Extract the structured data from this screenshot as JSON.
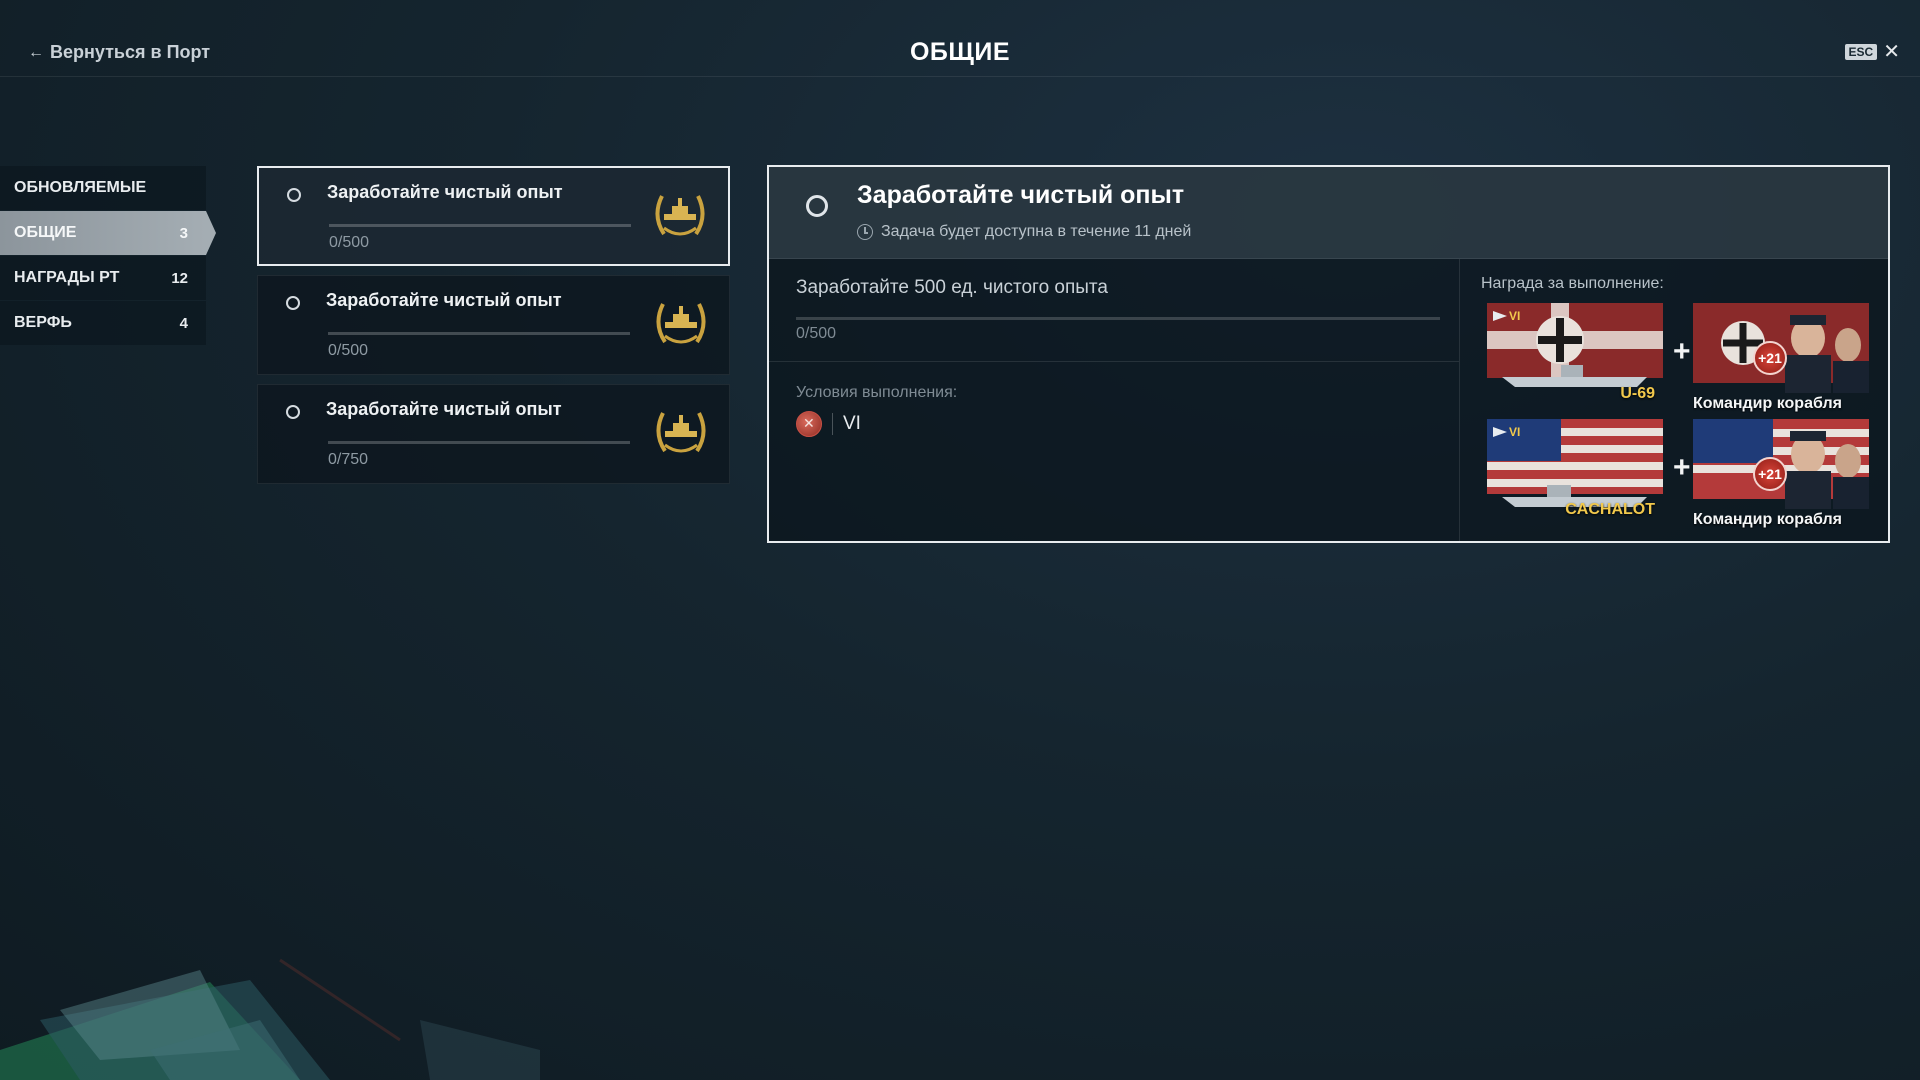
{
  "header": {
    "back_label": "Вернуться в Порт",
    "title": "ОБЩИЕ",
    "esc_label": "ESC"
  },
  "sidebar": {
    "items": [
      {
        "label": "ОБНОВЛЯЕМЫЕ",
        "count": ""
      },
      {
        "label": "ОБЩИЕ",
        "count": "3",
        "active": true
      },
      {
        "label": "НАГРАДЫ РТ",
        "count": "12"
      },
      {
        "label": "ВЕРФЬ",
        "count": "4"
      }
    ]
  },
  "tasks": [
    {
      "title": "Заработайте чистый опыт",
      "progress": "0/500",
      "selected": true
    },
    {
      "title": "Заработайте чистый опыт",
      "progress": "0/500"
    },
    {
      "title": "Заработайте чистый опыт",
      "progress": "0/750"
    }
  ],
  "detail": {
    "title": "Заработайте чистый опыт",
    "availability": "Задача будет доступна в течение 11 дней",
    "objective": "Заработайте 500 ед. чистого опыта",
    "progress": "0/500",
    "conditions_label": "Условия выполнения:",
    "condition_tier": "VI",
    "reward_label": "Награда за выполнение:",
    "rewards": [
      {
        "tier": "VI",
        "ship": "U-69",
        "commander": "Командир корабля",
        "bonus": "+21",
        "flag": "germany"
      },
      {
        "tier": "VI",
        "ship": "CACHALOT",
        "commander": "Командир корабля",
        "bonus": "+21",
        "flag": "usa"
      }
    ],
    "plus_sign": "+"
  },
  "icons": {
    "back": "arrow-left-icon",
    "close": "close-icon",
    "clock": "clock-icon",
    "emblem": "laurel-emblem-icon",
    "nation": "nation-icon"
  },
  "colors": {
    "accent_gold": "#f2c94c",
    "frame": "#e8ecef",
    "active_tab": "#a4adb3"
  }
}
